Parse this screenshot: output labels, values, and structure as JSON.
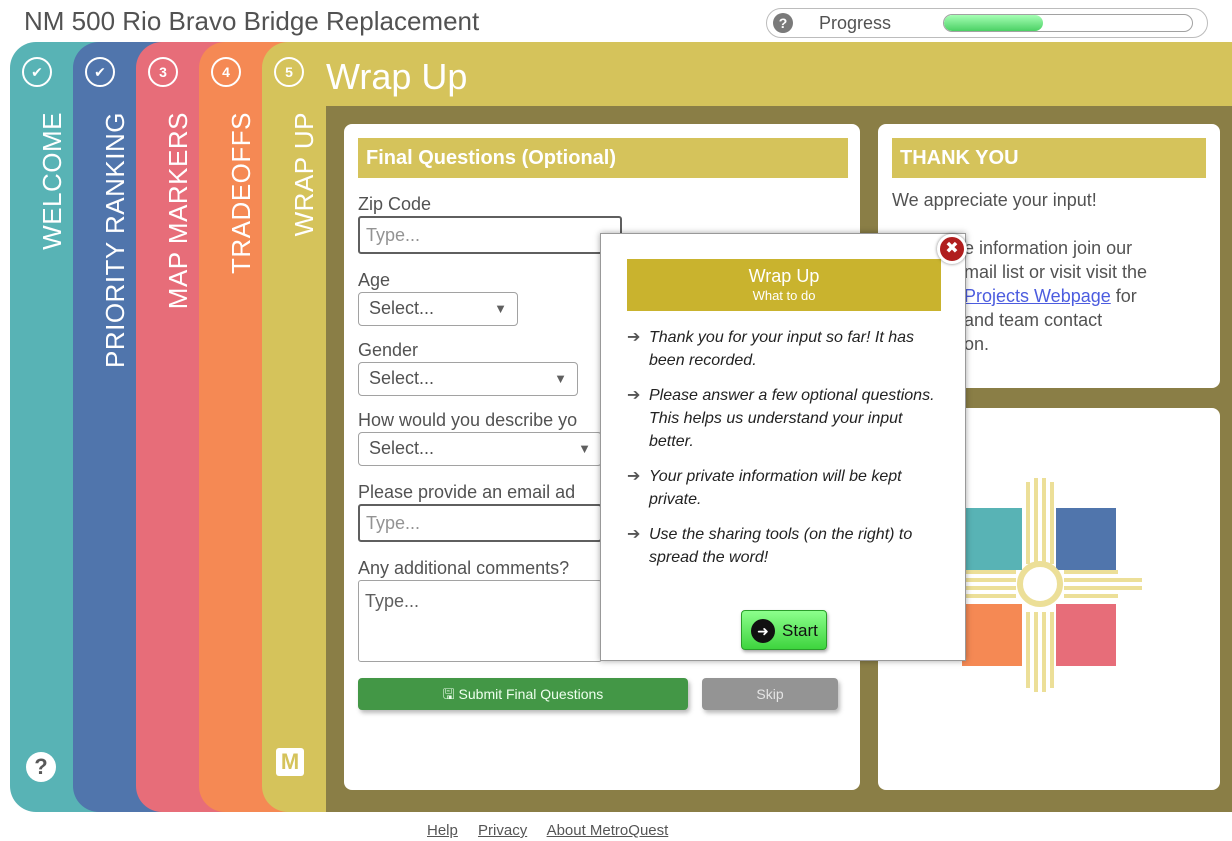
{
  "app": {
    "title": "NM 500 Rio Bravo Bridge Replacement"
  },
  "progress": {
    "help_icon": "?",
    "label": "Progress",
    "value_percent": 40
  },
  "tabs": [
    {
      "badge": "✔",
      "label": "WELCOME",
      "status": "complete",
      "color": "#2a9ea0"
    },
    {
      "badge": "✔",
      "label": "PRIORITY RANKING",
      "status": "complete",
      "color": "#1f4f95"
    },
    {
      "badge": "3",
      "label": "MAP MARKERS",
      "status": "pending",
      "color": "#e14454"
    },
    {
      "badge": "4",
      "label": "TRADEOFFS",
      "status": "pending",
      "color": "#f26824"
    },
    {
      "badge": "5",
      "label": "WRAP UP",
      "status": "active",
      "color": "#c9b32e"
    }
  ],
  "sidebar": {
    "help_icon": "?",
    "logo_icon": "metroquest-logo-icon"
  },
  "wrap_up": {
    "title": "Wrap Up",
    "form": {
      "heading": "Final Questions (Optional)",
      "zip_label": "Zip Code",
      "zip_placeholder": "Type...",
      "age_label": "Age",
      "age_value": "Select...",
      "gender_label": "Gender",
      "gender_value": "Select...",
      "describe_label": "How would you describe yo",
      "describe_value": "Select...",
      "email_label": "Please provide an email ad",
      "email_placeholder": "Type...",
      "comments_label": "Any additional comments?",
      "comments_placeholder": "Type...",
      "submit_label": "Submit Final Questions",
      "skip_label": "Skip"
    },
    "thanks": {
      "heading": "THANK YOU",
      "line1": "We appreciate your input!",
      "line2": "e information join our",
      "line3": "mail list or visit visit the",
      "link": "Projects Webpage",
      "line4_suffix": "for",
      "line5": "and team contact",
      "line6": "on."
    }
  },
  "modal": {
    "close_icon": "✖",
    "title": "Wrap Up",
    "subtitle": "What to do",
    "items": [
      "Thank you for your input so far! It has been recorded.",
      "Please answer a few optional questions. This helps us understand your input better.",
      "Your private information will be kept private.",
      "Use the sharing tools (on the right) to spread the word!"
    ],
    "start_label": "Start"
  },
  "footer": {
    "links": [
      "Help",
      "Privacy",
      "About MetroQuest"
    ]
  },
  "colors": {
    "accent": "#c9b32e",
    "submit": "#0f7a12",
    "start": "#3ed43e",
    "link": "#1a2fd6"
  }
}
